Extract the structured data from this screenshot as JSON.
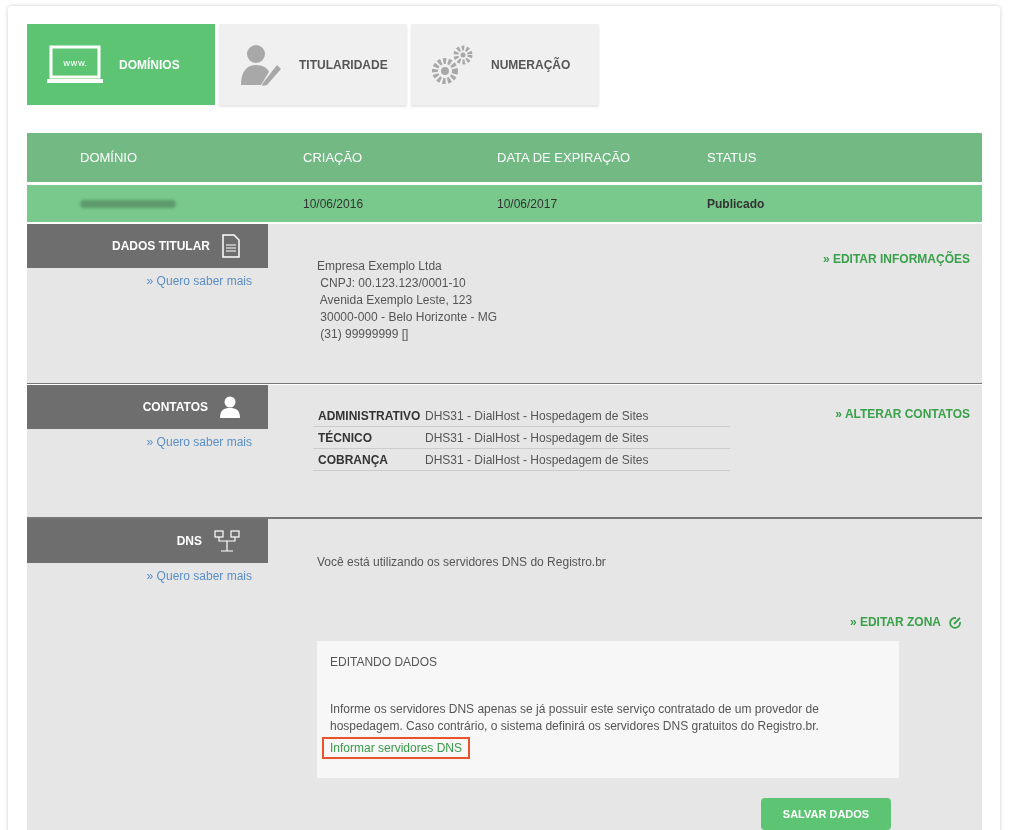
{
  "tabs": [
    {
      "kind": "www",
      "icon_text": "www.",
      "label": "DOMÍNIOS",
      "selected": true
    },
    {
      "kind": "person",
      "label": "TITULARIDADE",
      "selected": false
    },
    {
      "kind": "gears",
      "label": "NUMERAÇÃO",
      "selected": false
    }
  ],
  "table": {
    "columns": [
      "DOMÍNIO",
      "CRIAÇÃO",
      "DATA DE EXPIRAÇÃO",
      "STATUS"
    ],
    "row": {
      "created": "10/06/2016",
      "expires": "10/06/2017",
      "status": "Publicado"
    }
  },
  "sections": [
    {
      "kind": "holder",
      "title": "DADOS TITULAR",
      "more_link": "» Quero saber mais",
      "action": "» EDITAR INFORMAÇÕES",
      "lines": [
        "Empresa Exemplo Ltda",
        " CNPJ: 00.123.123/0001-10",
        " Avenida Exemplo Leste, 123",
        " 30000-000 - Belo Horizonte - MG",
        " (31) 99999999 []"
      ]
    },
    {
      "kind": "contacts",
      "title": "CONTATOS",
      "more_link": "» Quero saber mais",
      "action": "» ALTERAR CONTATOS",
      "contacts": [
        {
          "role": "ADMINISTRATIVO",
          "value": "DHS31 - DialHost - Hospedagem de Sites"
        },
        {
          "role": "TÉCNICO",
          "value": "DHS31 - DialHost - Hospedagem de Sites"
        },
        {
          "role": "COBRANÇA",
          "value": "DHS31 - DialHost - Hospedagem de Sites"
        }
      ]
    },
    {
      "kind": "dns",
      "title": "DNS",
      "more_link": "» Quero saber mais",
      "status_text": "Você está utilizando os servidores DNS do Registro.br",
      "action": "» EDITAR ZONA",
      "edit_panel": {
        "title": "EDITANDO DADOS",
        "text": "Informe os servidores DNS apenas se já possuir este serviço contratado de um provedor de hospedagem. Caso contrário, o sistema definirá os servidores DNS gratuitos do Registro.br.",
        "link": {
          "label": "Informar servidores DNS",
          "highlighted": true
        }
      },
      "save_button": "SALVAR DADOS"
    }
  ]
}
